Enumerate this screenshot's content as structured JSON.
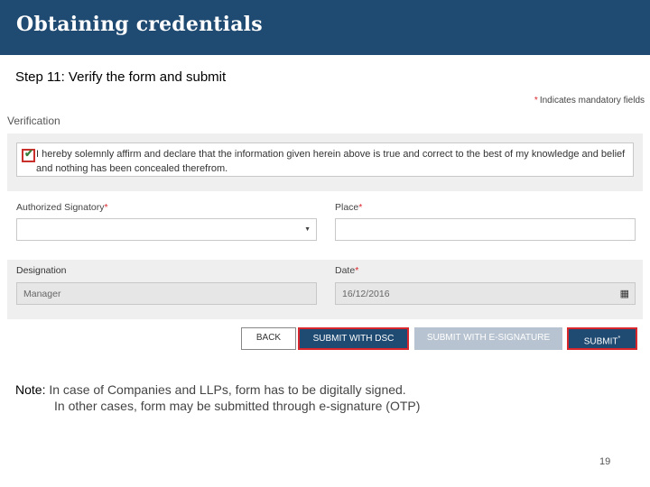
{
  "header": {
    "title": "Obtaining credentials"
  },
  "step": "Step 11: Verify the form and submit",
  "form": {
    "mandatory_note": "Indicates mandatory fields",
    "section_title": "Verification",
    "declaration": {
      "checked": true,
      "text": "I hereby solemnly affirm and declare that the information given herein above is true and correct to the best of my knowledge and belief and nothing has been concealed therefrom."
    },
    "authorized_signatory": {
      "label": "Authorized Signatory",
      "value": ""
    },
    "place": {
      "label": "Place",
      "value": ""
    },
    "designation": {
      "label": "Designation",
      "value": "Manager"
    },
    "date": {
      "label": "Date",
      "value": "16/12/2016"
    },
    "required_mark": "*",
    "buttons": {
      "back": "BACK",
      "submit_dsc": "SUBMIT WITH DSC",
      "submit_esign": "SUBMIT WITH E-SIGNATURE",
      "submit": "SUBMIT",
      "submit_sup": "*"
    }
  },
  "note": {
    "label": "Note:",
    "line1": " In case of Companies and LLPs, form has to be digitally signed.",
    "line2": "In other cases, form may be submitted through e-signature (OTP)"
  },
  "page_number": "19",
  "colors": {
    "brand": "#1f4a72",
    "highlight": "#d9262d",
    "disabled": "#b7c3d0"
  },
  "icons": {
    "calendar": "calendar-icon",
    "dropdown": "chevron-down-icon",
    "check": "check-icon"
  }
}
